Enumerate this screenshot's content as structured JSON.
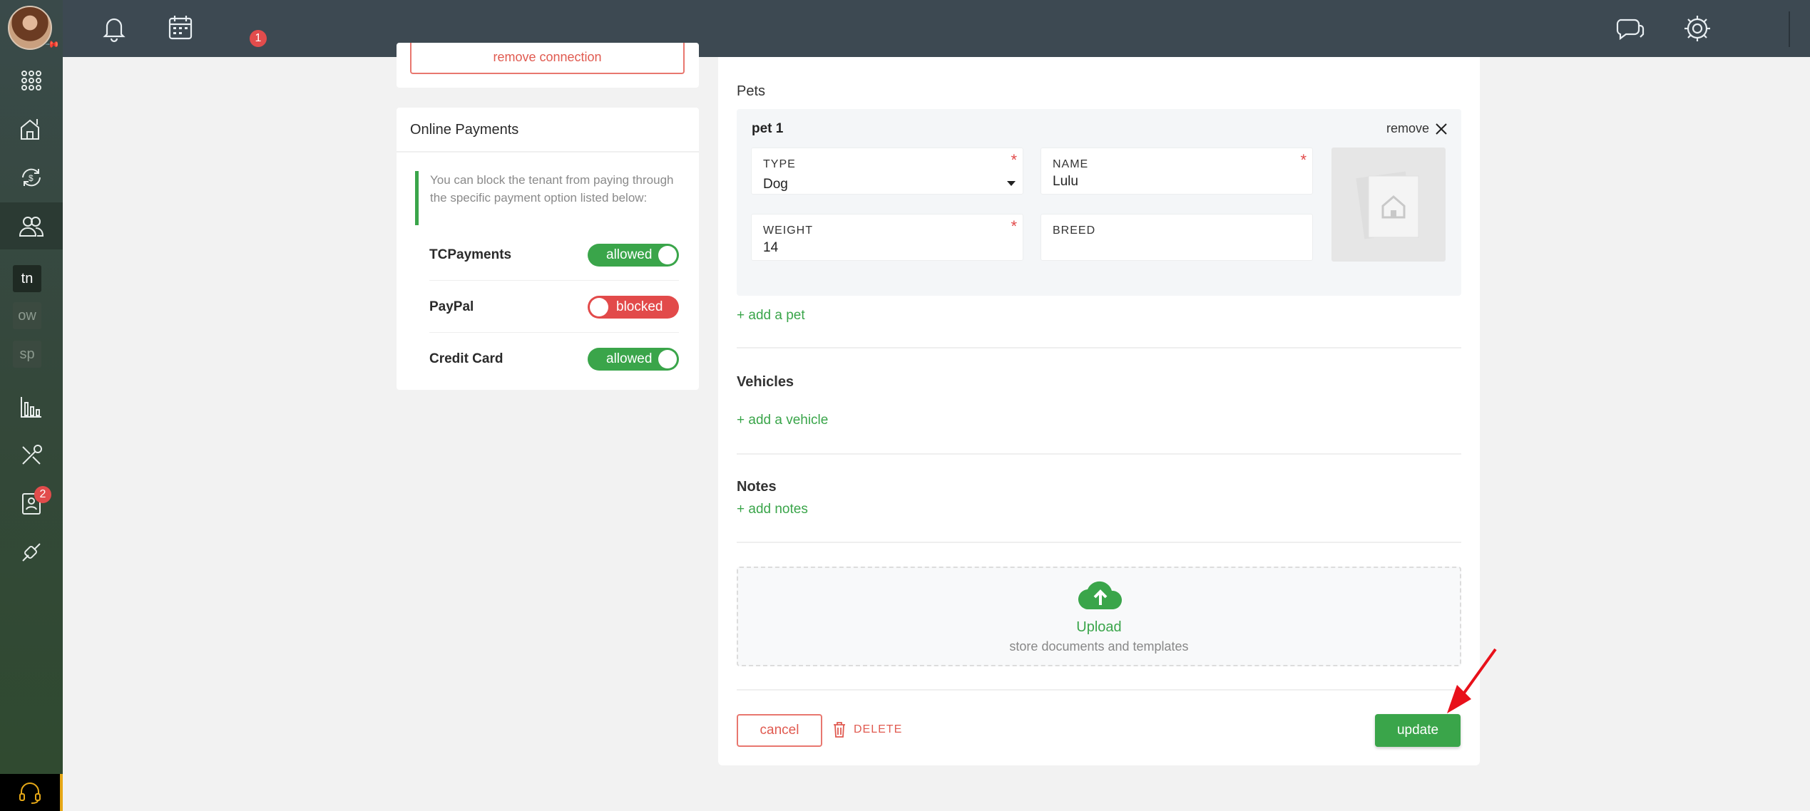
{
  "topbar": {
    "calendar_badge": "1"
  },
  "sidebar": {
    "text_items": [
      "tn",
      "ow",
      "sp"
    ],
    "contacts_badge": "2"
  },
  "connection": {
    "remove_label": "remove connection"
  },
  "online_payments": {
    "title": "Online Payments",
    "note": "You can block the tenant from paying through the specific payment option listed below:",
    "options": [
      {
        "label": "TCPayments",
        "status": "allowed"
      },
      {
        "label": "PayPal",
        "status": "blocked"
      },
      {
        "label": "Credit Card",
        "status": "allowed"
      }
    ]
  },
  "pets": {
    "title": "Pets",
    "pet": {
      "name": "pet 1",
      "remove_label": "remove",
      "type_label": "TYPE",
      "type_value": "Dog",
      "name_label": "NAME",
      "name_value": "Lulu",
      "weight_label": "WEIGHT",
      "weight_value": "14",
      "breed_label": "BREED",
      "breed_value": ""
    },
    "add_label": "+ add a pet"
  },
  "vehicles": {
    "title": "Vehicles",
    "add_label": "+ add a vehicle"
  },
  "notes": {
    "title": "Notes",
    "add_label": "+ add notes"
  },
  "upload": {
    "title": "Upload",
    "subtitle": "store documents and templates"
  },
  "actions": {
    "cancel": "cancel",
    "delete": "DELETE",
    "update": "update"
  },
  "colors": {
    "accent": "#3aa54a",
    "danger": "#e24a4a",
    "topbar": "#3d4952"
  }
}
